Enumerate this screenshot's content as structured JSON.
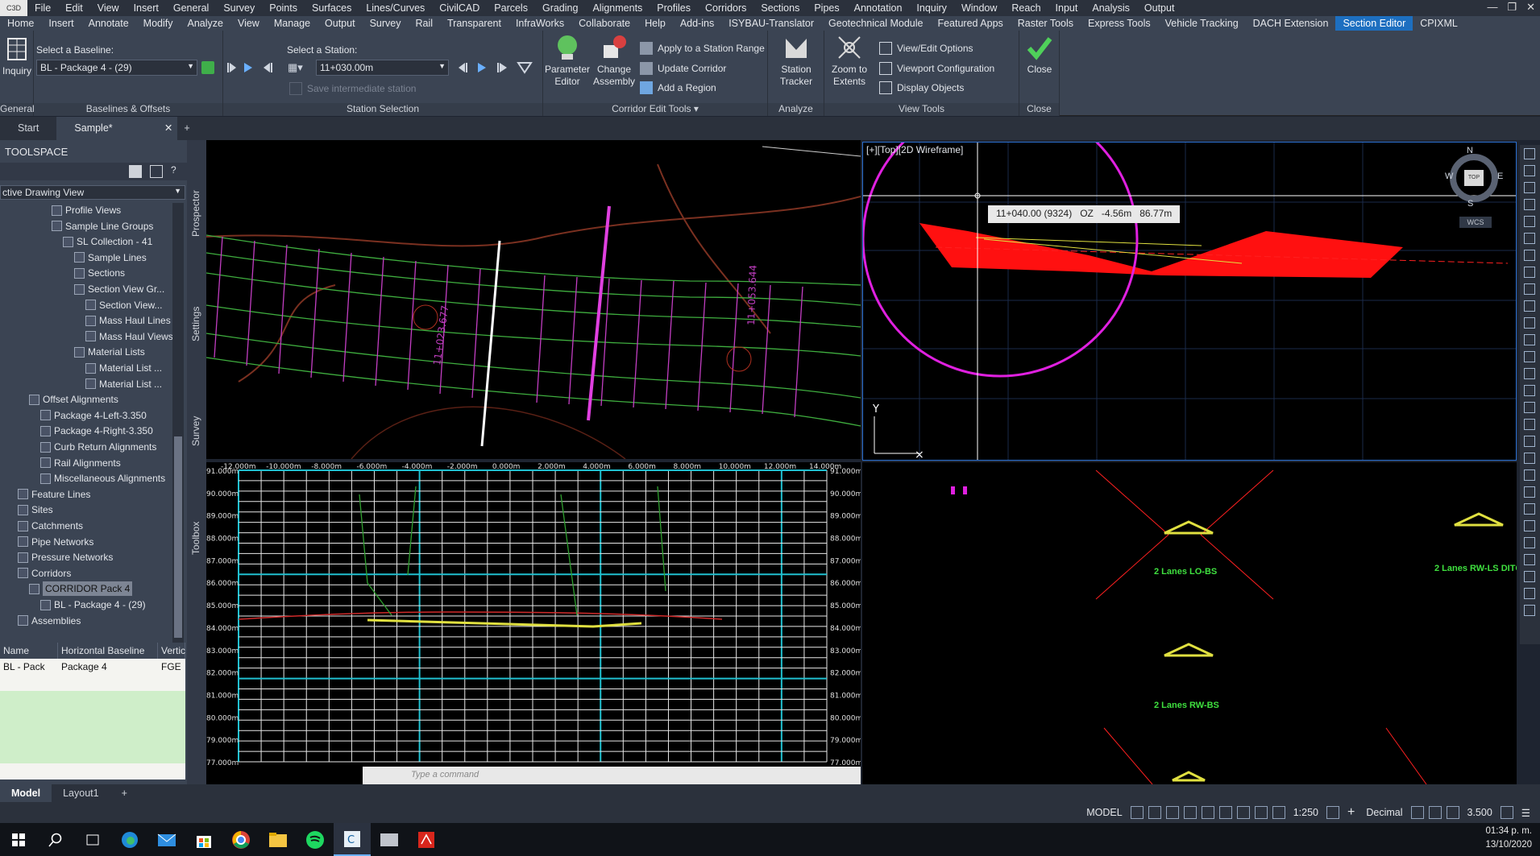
{
  "menubar": {
    "app_logo": "C3D",
    "items": [
      "File",
      "Edit",
      "View",
      "Insert",
      "General",
      "Survey",
      "Points",
      "Surfaces",
      "Lines/Curves",
      "CivilCAD",
      "Parcels",
      "Grading",
      "Alignments",
      "Profiles",
      "Corridors",
      "Sections",
      "Pipes",
      "Annotation",
      "Inquiry",
      "Window",
      "Reach",
      "Input",
      "Analysis",
      "Output"
    ]
  },
  "ribbon_tabs": [
    "Home",
    "Insert",
    "Annotate",
    "Modify",
    "Analyze",
    "View",
    "Manage",
    "Output",
    "Survey",
    "Rail",
    "Transparent",
    "InfraWorks",
    "Collaborate",
    "Help",
    "Add-ins",
    "ISYBAU-Translator",
    "Geotechnical Module",
    "Featured Apps",
    "Raster Tools",
    "Express Tools",
    "Vehicle Tracking",
    "DACH Extension",
    "Section Editor",
    "CPIXML"
  ],
  "active_ribbon_tab": "Section Editor",
  "ribbon": {
    "general": {
      "inquiry_label": "Inquiry",
      "title": "General"
    },
    "baselines": {
      "select_label": "Select a Baseline:",
      "baseline_value": "BL - Package 4 - (29)",
      "title": "Baselines & Offsets"
    },
    "station": {
      "select_label": "Select a Station:",
      "station_value": "11+030.00m",
      "save_label": "Save intermediate station",
      "title": "Station Selection"
    },
    "corridor_edit": {
      "parameter_editor": "Parameter Editor",
      "change_assembly": "Change Assembly",
      "apply_range": "Apply to a Station Range",
      "update_corridor": "Update Corridor",
      "add_region": "Add a Region",
      "title": "Corridor Edit Tools"
    },
    "analyze": {
      "station_tracker": "Station Tracker",
      "title": "Analyze"
    },
    "view_tools": {
      "zoom_extents": "Zoom to Extents",
      "view_edit": "View/Edit Options",
      "viewport_config": "Viewport Configuration",
      "display_objects": "Display Objects",
      "title": "View Tools"
    },
    "close": {
      "label": "Close",
      "title": "Close"
    }
  },
  "doc_tabs": [
    "Start",
    "Sample*"
  ],
  "toolspace": {
    "title": "TOOLSPACE",
    "view_select": "ctive Drawing View",
    "tree": [
      "Profile Views",
      "Sample Line Groups",
      "SL Collection - 41",
      "Sample Lines",
      "Sections",
      "Section View Gr...",
      "Section View...",
      "Mass Haul Lines",
      "Mass Haul Views",
      "Material Lists",
      "Material List ...",
      "Material List ...",
      "Offset Alignments",
      "Package 4-Left-3.350",
      "Package 4-Right-3.350",
      "Curb Return Alignments",
      "Rail Alignments",
      "Miscellaneous Alignments",
      "Feature Lines",
      "Sites",
      "Catchments",
      "Pipe Networks",
      "Pressure Networks",
      "Corridors",
      "CORRIDOR Pack 4",
      "BL - Package 4 - (29)",
      "Assemblies"
    ],
    "side_tabs": [
      "Prospector",
      "Settings",
      "Survey",
      "Toolbox"
    ],
    "grid_headers": [
      "Name",
      "Horizontal Baseline",
      "Vertic"
    ],
    "grid_row": [
      "BL - Pack",
      "Package 4",
      "FGE"
    ]
  },
  "viewports": {
    "plan": {
      "station_label_1": "11+023.677",
      "station_label_2": "11+053.644"
    },
    "top": {
      "label": "[+][Top][2D Wireframe]",
      "tooltip": "11+040.00 (9324)   OZ   -4.56m   86.77m",
      "compass": [
        "N",
        "W",
        "E",
        "S"
      ],
      "top_label": "TOP",
      "wcs": "WCS",
      "y_axis": "Y"
    },
    "section": {
      "x_ticks": [
        "-12.000m",
        "-10.000m",
        "-8.000m",
        "-6.000m",
        "-4.000m",
        "-2.000m",
        "0.000m",
        "2.000m",
        "4.000m",
        "6.000m",
        "8.000m",
        "10.000m",
        "12.000m",
        "14.000m"
      ],
      "y_ticks": [
        "91.000m",
        "90.000m",
        "89.000m",
        "88.000m",
        "87.000m",
        "86.000m",
        "85.000m",
        "84.000m",
        "83.000m",
        "82.000m",
        "81.000m",
        "80.000m",
        "79.000m",
        "77.000m"
      ],
      "command_placeholder": "Type a command"
    },
    "assembly": {
      "labels": [
        "2 Lanes LO-BS",
        "2 Lanes RW-LS DITC",
        "2 Lanes RW-BS"
      ]
    }
  },
  "layout_tabs": [
    "Model",
    "Layout1"
  ],
  "status": {
    "model": "MODEL",
    "scale": "1:250",
    "units": "Decimal",
    "value": "3.500"
  },
  "clock": {
    "time": "01:34 p. m.",
    "date": "13/10/2020"
  }
}
